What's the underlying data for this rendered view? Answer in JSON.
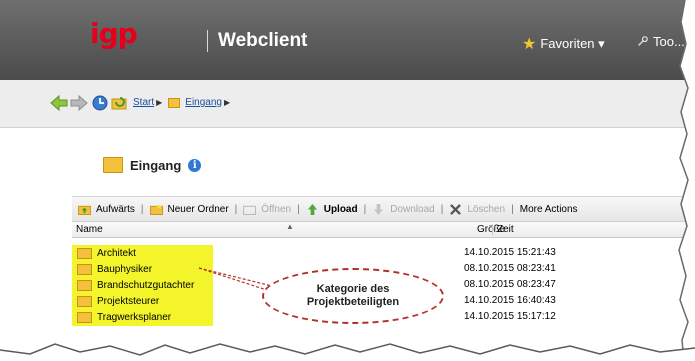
{
  "header": {
    "logo": "igp",
    "app_title": "Webclient",
    "favorites_label": "Favoriten ▾",
    "tools_label": "Too..."
  },
  "breadcrumb": {
    "start": "Start",
    "inbox": "Eingang"
  },
  "page": {
    "title": "Eingang",
    "info_icon": "info-icon"
  },
  "toolbar": {
    "up": "Aufwärts",
    "new_folder": "Neuer Ordner",
    "open": "Öffnen",
    "upload": "Upload",
    "download": "Download",
    "delete": "Löschen",
    "more": "More Actions"
  },
  "columns": {
    "name": "Name",
    "size": "Größe",
    "time": "Zeit"
  },
  "rows": [
    {
      "name": "Architekt",
      "time": "14.10.2015 15:21:43"
    },
    {
      "name": "Bauphysiker",
      "time": "08.10.2015 08:23:41"
    },
    {
      "name": "Brandschutzgutachter",
      "time": "08.10.2015 08:23:47"
    },
    {
      "name": "Projektsteurer",
      "time": "14.10.2015 16:40:43"
    },
    {
      "name": "Tragwerksplaner",
      "time": "14.10.2015 15:17:12"
    }
  ],
  "callout": {
    "line1": "Kategorie des",
    "line2": "Projektbeteiligten"
  },
  "colors": {
    "header": "#555555",
    "logo": "#e2001a",
    "highlight": "#f3f52a",
    "callout_border": "#b3312b"
  }
}
